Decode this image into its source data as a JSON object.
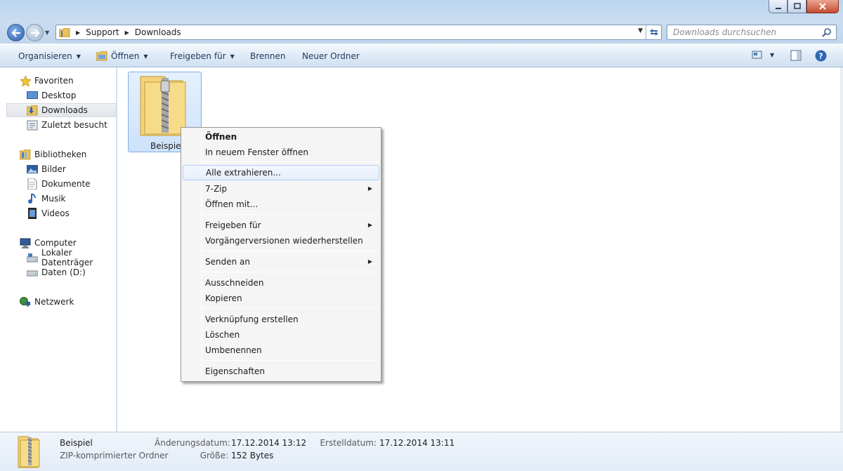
{
  "address": {
    "crumbs": [
      "Support",
      "Downloads"
    ],
    "search_placeholder": "Downloads durchsuchen"
  },
  "toolbar": {
    "organize": "Organisieren",
    "open": "Öffnen",
    "share": "Freigeben für",
    "burn": "Brennen",
    "new_folder": "Neuer Ordner"
  },
  "nav": {
    "favorites": "Favoriten",
    "desktop": "Desktop",
    "downloads": "Downloads",
    "recent": "Zuletzt besucht",
    "libraries": "Bibliotheken",
    "pictures": "Bilder",
    "documents": "Dokumente",
    "music": "Musik",
    "videos": "Videos",
    "computer": "Computer",
    "local_disk": "Lokaler Datenträger",
    "data_disk": "Daten (D:)",
    "network": "Netzwerk"
  },
  "file": {
    "name": "Beispiel"
  },
  "context_menu": {
    "open": "Öffnen",
    "open_new_window": "In neuem Fenster öffnen",
    "extract_all": "Alle extrahieren...",
    "seven_zip": "7-Zip",
    "open_with": "Öffnen mit...",
    "share_with": "Freigeben für",
    "restore_versions": "Vorgängerversionen wiederherstellen",
    "send_to": "Senden an",
    "cut": "Ausschneiden",
    "copy": "Kopieren",
    "create_shortcut": "Verknüpfung erstellen",
    "delete": "Löschen",
    "rename": "Umbenennen",
    "properties": "Eigenschaften"
  },
  "details": {
    "name": "Beispiel",
    "type": "ZIP-komprimierter Ordner",
    "modified_label": "Änderungsdatum:",
    "modified_value": "17.12.2014 13:12",
    "created_label": "Erstelldatum:",
    "created_value": "17.12.2014 13:11",
    "size_label": "Größe:",
    "size_value": "152 Bytes"
  }
}
